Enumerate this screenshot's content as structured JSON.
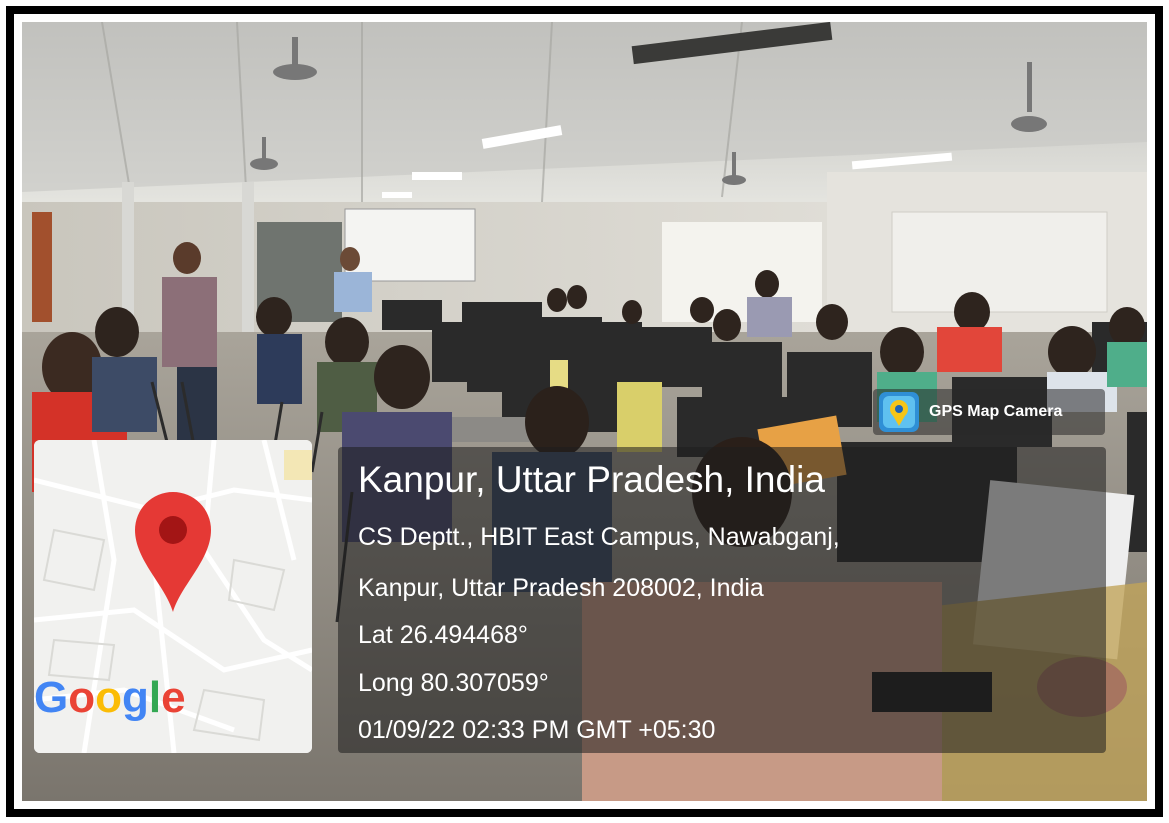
{
  "overlay": {
    "app_badge": "GPS Map Camera",
    "map_logo": [
      "G",
      "o",
      "o",
      "g",
      "l",
      "e"
    ],
    "logo_colors": [
      "#4285F4",
      "#EA4335",
      "#FBBC05",
      "#4285F4",
      "#34A853",
      "#EA4335"
    ],
    "pin_color": "#E53935",
    "location_title": "Kanpur, Uttar Pradesh, India",
    "address_line1": "CS Deptt., HBIT East Campus, Nawabganj,",
    "address_line2": "Kanpur, Uttar Pradesh 208002, India",
    "latitude": "Lat 26.494468°",
    "longitude": "Long 80.307059°",
    "datetime": "01/09/22 02:33 PM GMT +05:30"
  },
  "icons": [
    "map-pin-icon",
    "gps-map-camera-icon"
  ]
}
